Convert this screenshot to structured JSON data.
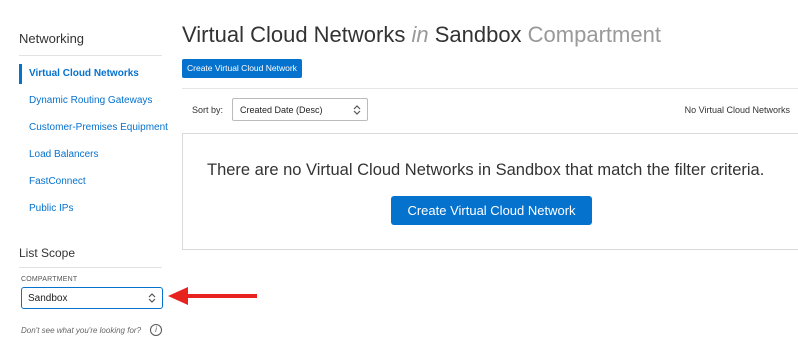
{
  "sidebar": {
    "title": "Networking",
    "items": [
      {
        "label": "Virtual Cloud Networks",
        "active": true
      },
      {
        "label": "Dynamic Routing Gateways"
      },
      {
        "label": "Customer-Premises Equipment"
      },
      {
        "label": "Load Balancers"
      },
      {
        "label": "FastConnect"
      },
      {
        "label": "Public IPs"
      }
    ],
    "scope_title": "List Scope",
    "compartment_label": "COMPARTMENT",
    "compartment_value": "Sandbox",
    "help_text": "Don't see what you're looking for?",
    "info_icon_glyph": "i"
  },
  "main": {
    "title_part1": "Virtual Cloud Networks ",
    "title_in": "in",
    "title_part2": " Sandbox ",
    "title_part3": "Compartment",
    "create_button_small": "Create Virtual Cloud Network",
    "sort_label": "Sort by:",
    "sort_value": "Created Date (Desc)",
    "count_text": "No Virtual Cloud Networks",
    "empty_message": "There are no Virtual Cloud Networks in Sandbox that match the filter criteria.",
    "create_button_big": "Create Virtual Cloud Network"
  },
  "icons": {
    "select_chevron": "⌃⌄"
  },
  "colors": {
    "accent": "#0572ce",
    "annotation_arrow": "#e8231f"
  }
}
